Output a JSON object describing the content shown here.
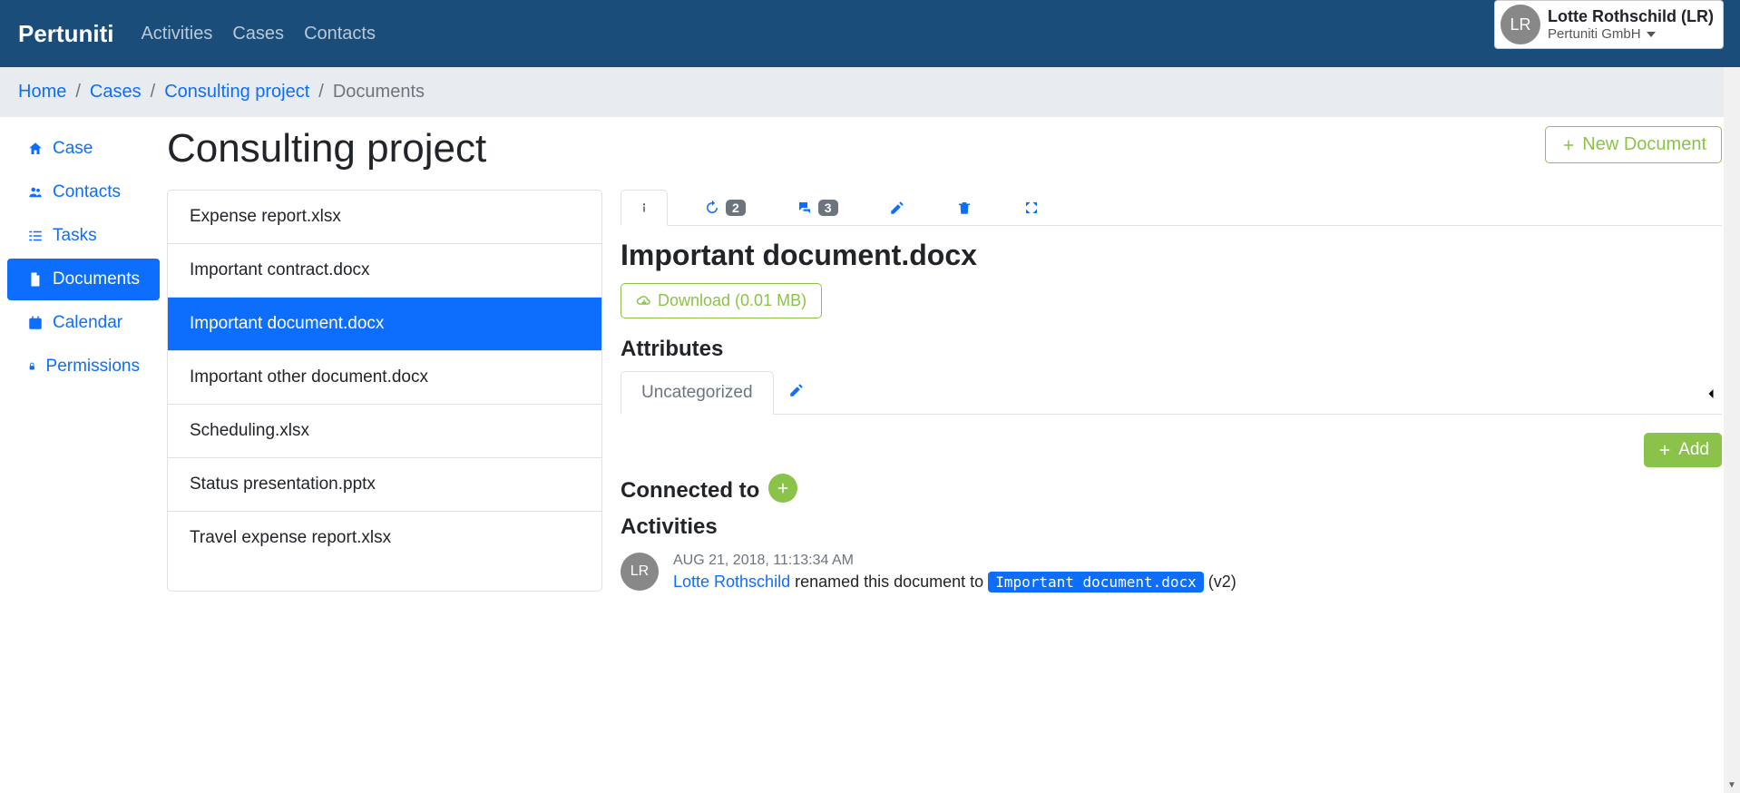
{
  "brand": "Pertuniti",
  "nav": {
    "activities": "Activities",
    "cases": "Cases",
    "contacts": "Contacts"
  },
  "user": {
    "initials": "LR",
    "name": "Lotte Rothschild (LR)",
    "org": "Pertuniti GmbH"
  },
  "breadcrumb": {
    "home": "Home",
    "cases": "Cases",
    "project": "Consulting project",
    "current": "Documents"
  },
  "sidebar": {
    "case": "Case",
    "contacts": "Contacts",
    "tasks": "Tasks",
    "documents": "Documents",
    "calendar": "Calendar",
    "permissions": "Permissions"
  },
  "page": {
    "title": "Consulting project",
    "new_document": "New Document"
  },
  "documents": [
    "Expense report.xlsx",
    "Important contract.docx",
    "Important document.docx",
    "Important other document.docx",
    "Scheduling.xlsx",
    "Status presentation.pptx",
    "Travel expense report.xlsx"
  ],
  "selected_document_index": 2,
  "detail": {
    "tabs": {
      "history_count": "2",
      "comments_count": "3"
    },
    "title": "Important document.docx",
    "download": "Download (0.01 MB)",
    "attributes_heading": "Attributes",
    "attributes_tab": "Uncategorized",
    "add_label": "Add",
    "connected_heading": "Connected to",
    "activities_heading": "Activities"
  },
  "activity": {
    "avatar": "LR",
    "timestamp": "AUG 21, 2018, 11:13:34 AM",
    "actor": "Lotte Rothschild",
    "text_middle": " renamed this document to ",
    "filename": "Important document.docx",
    "version": " (v2)"
  }
}
